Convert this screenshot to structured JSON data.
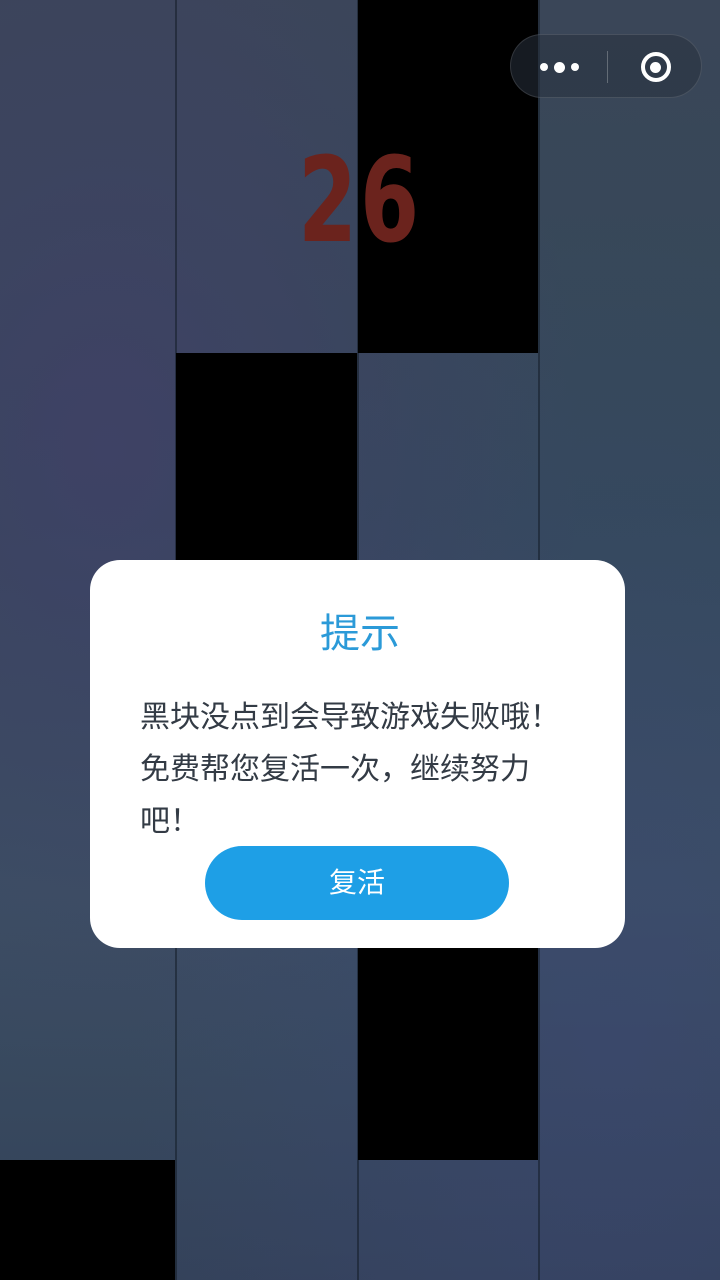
{
  "game": {
    "score": "26"
  },
  "capsule": {
    "more_icon": "more-dots-icon",
    "close_icon": "target-circle-icon"
  },
  "dialog": {
    "title": "提示",
    "message": "黑块没点到会导致游戏失败哦！免费帮您复活一次，继续努力吧！",
    "button_label": "复活",
    "accent_color": "#1e9fe6"
  }
}
